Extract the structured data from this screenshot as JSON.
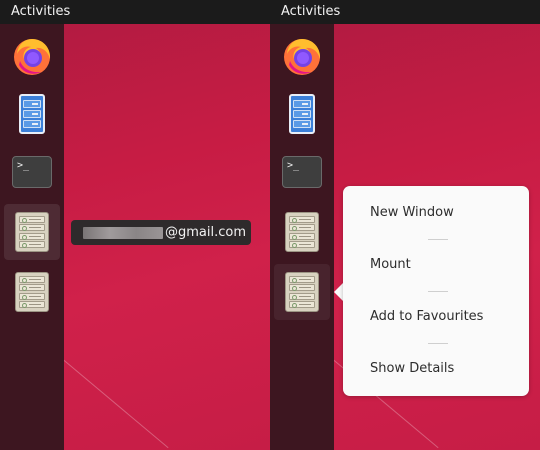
{
  "left": {
    "topbar": {
      "title": "Activities"
    },
    "dock": {
      "items": [
        {
          "name": "firefox",
          "icon": "firefox-icon"
        },
        {
          "name": "files",
          "icon": "file-cabinet-icon"
        },
        {
          "name": "terminal",
          "icon": "terminal-icon",
          "glyph": ">_"
        },
        {
          "name": "drive-1",
          "icon": "drive-icon"
        },
        {
          "name": "drive-2",
          "icon": "drive-icon"
        }
      ]
    },
    "tooltip": {
      "text": "@gmail.com"
    }
  },
  "right": {
    "topbar": {
      "title": "Activities"
    },
    "context_menu": {
      "items": [
        {
          "label": "New Window"
        },
        {
          "label": "Mount"
        },
        {
          "label": "Add to Favourites"
        },
        {
          "label": "Show Details"
        }
      ]
    }
  },
  "colors": {
    "topbar": "#1b1b1b",
    "dock": "#3d1620",
    "wallpaper": "#c71c44",
    "menu_bg": "#fafafa"
  }
}
